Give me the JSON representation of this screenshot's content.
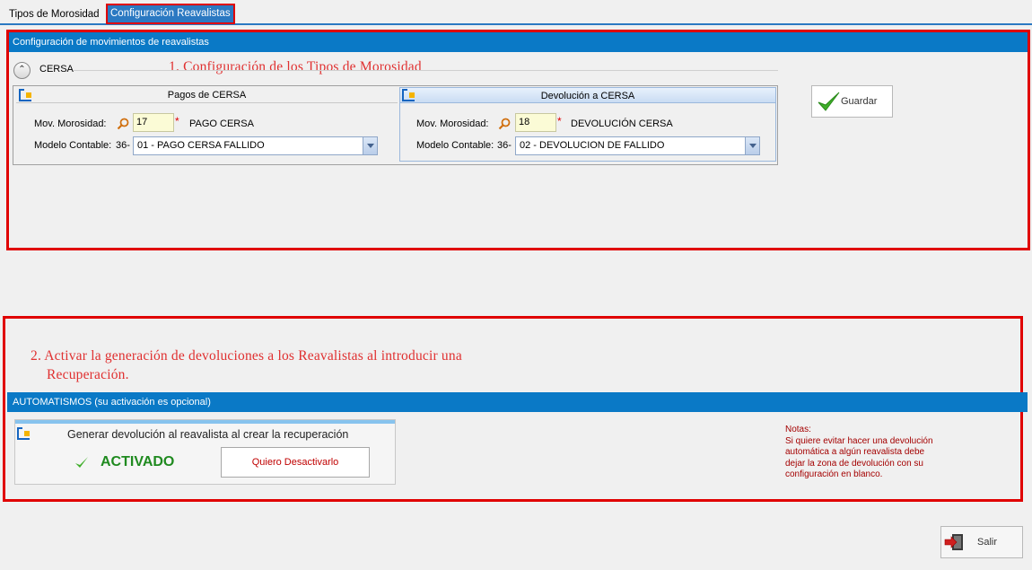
{
  "tabs": [
    {
      "label": "Tipos de Morosidad"
    },
    {
      "label": "Configuración Reavalistas"
    }
  ],
  "section1": {
    "header": "Configuración de movimientos de reavalistas",
    "annotation": "1. Configuración de los Tipos de Morosidad",
    "group_label": "CERSA",
    "pagos": {
      "title": "Pagos de CERSA",
      "mov_label": "Mov. Morosidad:",
      "mov_value": "17",
      "required": "*",
      "mov_desc": "PAGO CERSA",
      "modelo_label": "Modelo Contable:",
      "modelo_prefix": "36-",
      "modelo_value": "01 - PAGO CERSA FALLIDO"
    },
    "devolucion": {
      "title": "Devolución a CERSA",
      "mov_label": "Mov. Morosidad:",
      "mov_value": "18",
      "required": "*",
      "mov_desc": "DEVOLUCIÓN CERSA",
      "modelo_label": "Modelo Contable:",
      "modelo_prefix": "36-",
      "modelo_value": "02 - DEVOLUCION DE FALLIDO"
    },
    "save_button": "Guardar"
  },
  "section2": {
    "annotation_line1": "2. Activar la generación de devoluciones a los Reavalistas al introducir una",
    "annotation_line2": "Recuperación.",
    "header": "AUTOMATISMOS (su activación es opcional)",
    "title": "Generar devolución al reavalista al crear la recuperación",
    "status": "ACTIVADO",
    "deactivate_button": "Quiero Desactivarlo",
    "notes_title": "Notas:",
    "notes_lines": [
      "Si quiere evitar hacer una devolución",
      "automática a algún reavalista debe",
      "dejar la zona de devolución con su",
      "configuración en blanco."
    ]
  },
  "exit_button": "Salir",
  "colors": {
    "accent": "#0a79c6",
    "highlight": "#e00000",
    "annotation": "#e03030",
    "status_ok": "#1f8a1f",
    "notes": "#a40000"
  }
}
